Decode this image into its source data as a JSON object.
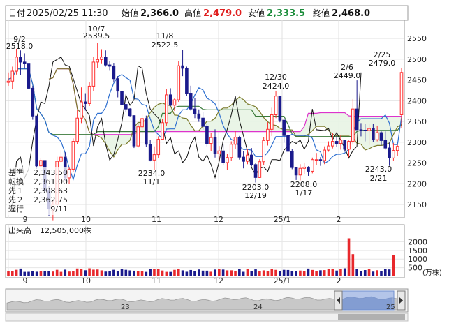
{
  "header": {
    "date_label": "日付",
    "datetime": "2025/02/25 11:30",
    "open_label": "始値",
    "open": "2,366.0",
    "high_label": "高値",
    "high": "2,479.0",
    "low_label": "安値",
    "low": "2,333.5",
    "close_label": "終値",
    "close": "2,468.0"
  },
  "colors": {
    "up": "#ff3030",
    "down": "#1a1a8c",
    "kijun": "#3a7a3a",
    "tenkan": "#2d6fd0",
    "senko1": "#7a7a2a",
    "senko2": "#dd33cc",
    "chikou": "#111111",
    "cloud_green": "#e8f4e4",
    "cloud_pink": "#f8e4f4",
    "vol_up": "#e8282c",
    "vol_down": "#1a1a8c"
  },
  "legend": [
    {
      "label": "基準",
      "value": "2,343.50",
      "color": "#3a7a3a"
    },
    {
      "label": "転換",
      "value": "2,361.00",
      "color": "#2d6fd0"
    },
    {
      "label": "先１",
      "value": "2,308.63",
      "color": "#6b6b2a"
    },
    {
      "label": "先２",
      "value": "2,362.75",
      "color": "#dd33cc"
    },
    {
      "label": "遅行",
      "value": "9/11",
      "color": "#111111"
    }
  ],
  "volume_panel": {
    "title": "出来高",
    "value": "12,505,000株",
    "ticks": [
      "2000",
      "1500",
      "1000",
      "500"
    ],
    "unit": "(万株)"
  },
  "navigator": {
    "labels": [
      "23",
      "24",
      "25"
    ]
  },
  "annotations": [
    {
      "date": "9/2",
      "value": "2518.0"
    },
    {
      "date": "10/7",
      "value": "2539.5"
    },
    {
      "date": "11/8",
      "value": "2522.5"
    },
    {
      "date": "12/30",
      "value": "2424.0"
    },
    {
      "date": "2/6",
      "value": "2449.0"
    },
    {
      "date": "2/25",
      "value": "2479.0"
    },
    {
      "value": "2234.0",
      "date": "11/1"
    },
    {
      "value": "2203.0",
      "date": "12/19"
    },
    {
      "value": "2208.0",
      "date": "1/17"
    },
    {
      "value": "2243.0",
      "date": "2/21"
    }
  ],
  "chart_data": {
    "type": "candlestick",
    "y_ticks": [
      2550,
      2500,
      2450,
      2400,
      2350,
      2300,
      2250,
      2200,
      2150
    ],
    "ylim": [
      2110,
      2580
    ],
    "x_ticks": [
      "9",
      "10",
      "11",
      "12",
      "25/1",
      "2"
    ],
    "grid": true,
    "series_names": [
      "基準",
      "転換",
      "先１",
      "先２",
      "遅行"
    ],
    "candles": [
      [
        2444.0,
        2468.0,
        2436.0,
        2447.0
      ],
      [
        2447.0,
        2482.0,
        2428.0,
        2471.0
      ],
      [
        2471.0,
        2525.0,
        2463.0,
        2505.0
      ],
      [
        2505.0,
        2521.0,
        2462.0,
        2493.0
      ],
      [
        2493.0,
        2514.0,
        2477.0,
        2490.0
      ],
      [
        2490.0,
        2490.0,
        2429.0,
        2430.0
      ],
      [
        2430.0,
        2436.0,
        2354.0,
        2363.0
      ],
      [
        2363.0,
        2363.0,
        2236.0,
        2243.0
      ],
      [
        2243.0,
        2262.0,
        2213.0,
        2256.0
      ],
      [
        2256.0,
        2256.0,
        2183.0,
        2184.0
      ],
      [
        2184.0,
        2195.0,
        2122.0,
        2139.0
      ],
      [
        2139.0,
        2160.0,
        2112.0,
        2150.0
      ],
      [
        2150.0,
        2265.0,
        2136.0,
        2254.0
      ],
      [
        2254.0,
        2281.0,
        2251.0,
        2264.0
      ],
      [
        2264.0,
        2276.0,
        2207.0,
        2214.0
      ],
      [
        2214.0,
        2239.0,
        2200.0,
        2235.0
      ],
      [
        2235.0,
        2309.0,
        2228.0,
        2302.0
      ],
      [
        2302.0,
        2378.0,
        2295.0,
        2358.0
      ],
      [
        2358.0,
        2432.0,
        2346.0,
        2397.0
      ],
      [
        2397.0,
        2418.0,
        2376.0,
        2393.0
      ],
      [
        2393.0,
        2444.0,
        2387.0,
        2435.0
      ],
      [
        2435.0,
        2506.0,
        2424.0,
        2493.0
      ],
      [
        2493.0,
        2539.0,
        2479.0,
        2499.0
      ],
      [
        2499.0,
        2524.0,
        2490.0,
        2505.0
      ],
      [
        2505.0,
        2521.0,
        2482.0,
        2486.0
      ],
      [
        2486.0,
        2496.0,
        2472.0,
        2483.0
      ],
      [
        2483.0,
        2491.0,
        2445.0,
        2453.0
      ],
      [
        2453.0,
        2459.0,
        2408.0,
        2423.0
      ],
      [
        2423.0,
        2424.0,
        2389.0,
        2391.0
      ],
      [
        2391.0,
        2402.0,
        2372.0,
        2380.0
      ],
      [
        2380.0,
        2382.0,
        2360.0,
        2364.0
      ],
      [
        2364.0,
        2364.0,
        2286.0,
        2291.0
      ],
      [
        2291.0,
        2346.0,
        2287.0,
        2337.0
      ],
      [
        2337.0,
        2366.0,
        2316.0,
        2357.0
      ],
      [
        2357.0,
        2364.0,
        2289.0,
        2295.0
      ],
      [
        2295.0,
        2306.0,
        2254.0,
        2257.0
      ],
      [
        2257.0,
        2290.0,
        2234.0,
        2270.0
      ],
      [
        2270.0,
        2314.0,
        2262.0,
        2307.0
      ],
      [
        2307.0,
        2356.0,
        2305.0,
        2347.0
      ],
      [
        2347.0,
        2429.0,
        2340.0,
        2414.0
      ],
      [
        2414.0,
        2430.0,
        2387.0,
        2389.0
      ],
      [
        2389.0,
        2406.0,
        2375.0,
        2402.0
      ],
      [
        2402.0,
        2495.0,
        2397.0,
        2484.0
      ],
      [
        2484.0,
        2522.0,
        2459.0,
        2478.0
      ],
      [
        2478.0,
        2482.0,
        2411.0,
        2418.0
      ],
      [
        2418.0,
        2436.0,
        2376.0,
        2380.0
      ],
      [
        2380.0,
        2406.0,
        2358.0,
        2368.0
      ],
      [
        2368.0,
        2379.0,
        2349.0,
        2358.0
      ],
      [
        2358.0,
        2372.0,
        2330.0,
        2338.0
      ],
      [
        2338.0,
        2345.0,
        2290.0,
        2297.0
      ],
      [
        2297.0,
        2323.0,
        2279.0,
        2311.0
      ],
      [
        2311.0,
        2331.0,
        2263.0,
        2272.0
      ],
      [
        2272.0,
        2291.0,
        2258.0,
        2279.0
      ],
      [
        2279.0,
        2294.0,
        2244.0,
        2251.0
      ],
      [
        2251.0,
        2271.0,
        2234.0,
        2263.0
      ],
      [
        2263.0,
        2302.0,
        2255.0,
        2295.0
      ],
      [
        2295.0,
        2328.0,
        2283.0,
        2312.0
      ],
      [
        2312.0,
        2315.0,
        2258.0,
        2264.0
      ],
      [
        2264.0,
        2278.0,
        2237.0,
        2254.0
      ],
      [
        2254.0,
        2284.0,
        2247.0,
        2269.0
      ],
      [
        2269.0,
        2286.0,
        2242.0,
        2246.0
      ],
      [
        2246.0,
        2250.0,
        2203.0,
        2215.0
      ],
      [
        2215.0,
        2259.0,
        2214.0,
        2253.0
      ],
      [
        2253.0,
        2312.0,
        2245.0,
        2304.0
      ],
      [
        2304.0,
        2348.0,
        2292.0,
        2331.0
      ],
      [
        2331.0,
        2383.0,
        2315.0,
        2366.0
      ],
      [
        2366.0,
        2424.0,
        2358.0,
        2411.0
      ],
      [
        2411.0,
        2411.0,
        2348.0,
        2353.0
      ],
      [
        2353.0,
        2355.0,
        2299.0,
        2316.0
      ],
      [
        2316.0,
        2346.0,
        2271.0,
        2278.0
      ],
      [
        2278.0,
        2283.0,
        2235.0,
        2239.0
      ],
      [
        2239.0,
        2240.0,
        2209.0,
        2221.0
      ],
      [
        2221.0,
        2247.0,
        2208.0,
        2237.0
      ],
      [
        2237.0,
        2251.0,
        2224.0,
        2240.0
      ],
      [
        2240.0,
        2242.0,
        2219.0,
        2230.0
      ],
      [
        2230.0,
        2263.0,
        2225.0,
        2258.0
      ],
      [
        2258.0,
        2274.0,
        2245.0,
        2258.0
      ],
      [
        2258.0,
        2264.0,
        2243.0,
        2256.0
      ],
      [
        2256.0,
        2290.0,
        2247.0,
        2281.0
      ],
      [
        2281.0,
        2302.0,
        2277.0,
        2291.0
      ],
      [
        2291.0,
        2323.0,
        2285.0,
        2302.0
      ],
      [
        2302.0,
        2315.0,
        2289.0,
        2297.0
      ],
      [
        2297.0,
        2316.0,
        2282.0,
        2305.0
      ],
      [
        2305.0,
        2305.0,
        2277.0,
        2283.0
      ],
      [
        2283.0,
        2304.0,
        2264.0,
        2302.0
      ],
      [
        2302.0,
        2404.0,
        2294.0,
        2380.0
      ],
      [
        2380.0,
        2449.0,
        2357.0,
        2330.0
      ],
      [
        2330.0,
        2346.0,
        2314.0,
        2329.0
      ],
      [
        2329.0,
        2345.0,
        2302.0,
        2328.0
      ],
      [
        2328.0,
        2345.0,
        2293.0,
        2333.0
      ],
      [
        2333.0,
        2345.0,
        2300.0,
        2306.0
      ],
      [
        2306.0,
        2340.0,
        2302.0,
        2323.0
      ],
      [
        2323.0,
        2326.0,
        2292.0,
        2304.0
      ],
      [
        2304.0,
        2326.0,
        2282.0,
        2286.0
      ],
      [
        2286.0,
        2299.0,
        2243.0,
        2262.0
      ],
      [
        2262.0,
        2298.0,
        2256.0,
        2280.0
      ],
      [
        2280.0,
        2294.0,
        2266.0,
        2290.0
      ],
      [
        2366.0,
        2479.0,
        2333.5,
        2468.0
      ]
    ],
    "volumes": [
      302,
      295,
      377,
      448,
      258,
      262,
      291,
      265,
      288,
      283,
      298,
      276,
      376,
      259,
      386,
      275,
      308,
      452,
      431,
      351,
      463,
      385,
      394,
      345,
      273,
      288,
      378,
      318,
      442,
      376,
      344,
      326,
      317,
      293,
      257,
      442,
      403,
      426,
      337,
      258,
      256,
      373,
      422,
      347,
      264,
      365,
      309,
      395,
      330,
      328,
      265,
      390,
      414,
      390,
      346,
      349,
      307,
      431,
      262,
      433,
      306,
      400,
      321,
      345,
      322,
      436,
      373,
      284,
      374,
      366,
      311,
      295,
      334,
      306,
      448,
      369,
      315,
      350,
      360,
      425,
      429,
      334,
      420,
      462,
      2200,
      1283,
      428,
      298,
      362,
      414,
      273,
      353,
      319,
      428,
      397,
      1251
    ],
    "volume_ticks": [
      2000,
      1500,
      1000,
      500
    ],
    "volume_max": 2300
  }
}
